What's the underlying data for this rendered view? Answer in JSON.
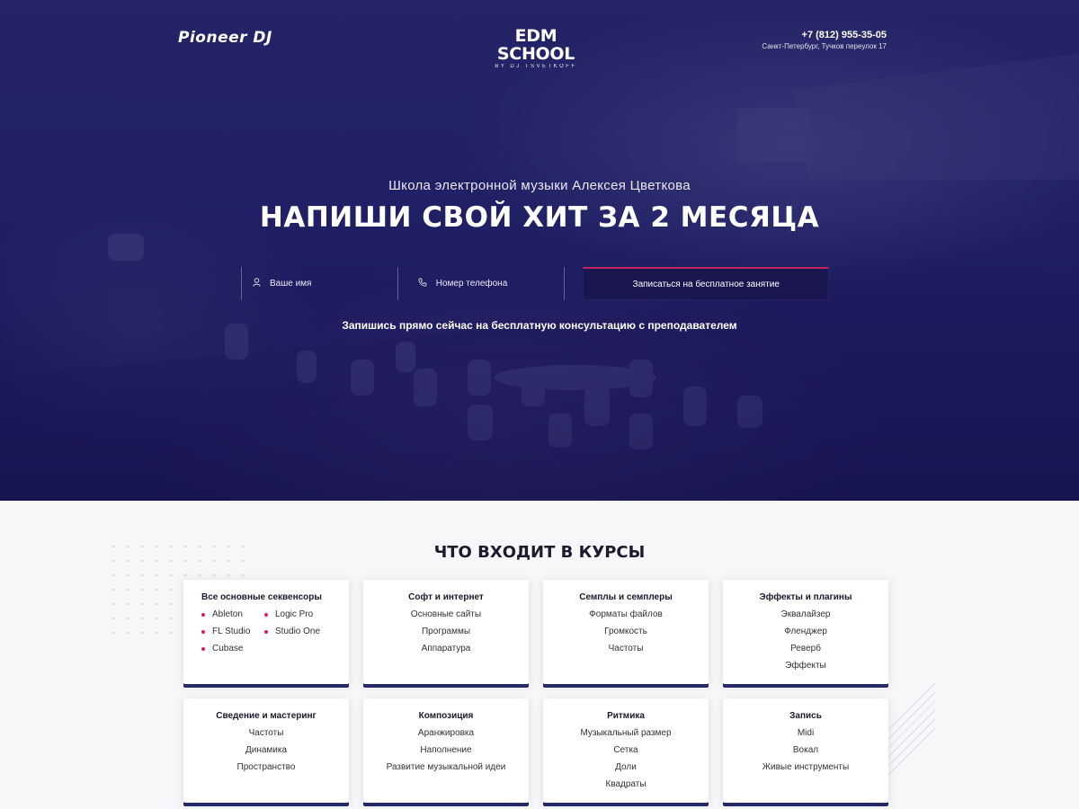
{
  "header": {
    "logo_left": "Pioneer DJ",
    "logo_center": "EDM SCHOOL",
    "logo_center_sub": "BY DJ TSVETKOFF",
    "phone": "+7 (812) 955-35-05",
    "address": "Санкт-Петербург, Тучков переулок 17"
  },
  "hero": {
    "subtitle": "Школа электронной музыки Алексея Цветкова",
    "headline": "НАПИШИ СВОЙ ХИТ ЗА 2 МЕСЯЦА",
    "name_placeholder": "Ваше имя",
    "phone_placeholder": "Номер телефона",
    "cta_label": "Записаться на бесплатное занятие",
    "cta_note": "Запишись прямо сейчас на бесплатную консультацию с преподавателем"
  },
  "courses": {
    "title": "ЧТО ВХОДИТ В КУРСЫ",
    "cards": [
      {
        "title": "Все основные секвенсоры",
        "items": [
          "Ableton",
          "Logic Pro",
          "FL Studio",
          "Studio One",
          "Cubase"
        ]
      },
      {
        "title": "Софт и интернет",
        "items": [
          "Основные сайты",
          "Программы",
          "Аппаратура"
        ]
      },
      {
        "title": "Семплы и семплеры",
        "items": [
          "Форматы файлов",
          "Громкость",
          "Частоты"
        ]
      },
      {
        "title": "Эффекты и плагины",
        "items": [
          "Эквалайзер",
          "Фленджер",
          "Реверб",
          "Эффекты"
        ]
      },
      {
        "title": "Сведение и мастеринг",
        "items": [
          "Частоты",
          "Динамика",
          "Пространство"
        ]
      },
      {
        "title": "Композиция",
        "items": [
          "Аранжировка",
          "Наполнение",
          "Развитие музыкальной идеи"
        ]
      },
      {
        "title": "Ритмика",
        "items": [
          "Музыкальный размер",
          "Сетка",
          "Доли",
          "Квадраты"
        ]
      },
      {
        "title": "Запись",
        "items": [
          "Midi",
          "Вокал",
          "Живые инструменты"
        ]
      }
    ]
  },
  "icons": {
    "name_field": "user-icon",
    "phone_field": "phone-icon"
  },
  "colors": {
    "hero_bg": "#23236a",
    "accent": "#d0245c",
    "card_shadow": "#242a66",
    "page_bg": "#f7f7f9"
  }
}
